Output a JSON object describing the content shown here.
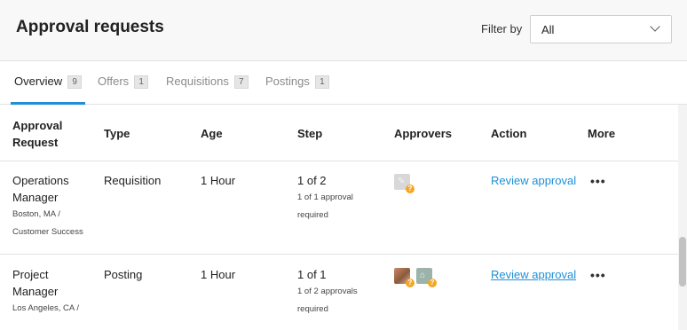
{
  "header": {
    "title": "Approval requests",
    "filter_label": "Filter by",
    "filter_value": "All"
  },
  "tabs": [
    {
      "label": "Overview",
      "count": "9",
      "active": true
    },
    {
      "label": "Offers",
      "count": "1",
      "active": false
    },
    {
      "label": "Requisitions",
      "count": "7",
      "active": false
    },
    {
      "label": "Postings",
      "count": "1",
      "active": false
    }
  ],
  "table": {
    "headers": {
      "request_line1": "Approval",
      "request_line2": "Request",
      "type": "Type",
      "age": "Age",
      "step": "Step",
      "approvers": "Approvers",
      "action": "Action",
      "more": "More"
    },
    "rows": [
      {
        "title_line1": "Operations",
        "title_line2": "Manager",
        "location_line1": "Boston, MA /",
        "location_line2": "Customer Success",
        "type": "Requisition",
        "age": "1 Hour",
        "step": "1 of 2",
        "step_note_line1": "1 of 1 approval",
        "step_note_line2": "required",
        "action": "Review approval",
        "more": "•••",
        "pending_mark": "?"
      },
      {
        "title_line1": "Project",
        "title_line2": "Manager",
        "location_line1": "Los Angeles, CA /",
        "type": "Posting",
        "age": "1 Hour",
        "step": "1 of 1",
        "step_note_line1": "1 of 2 approvals",
        "step_note_line2": "required",
        "action": "Review approval",
        "more": "•••",
        "pending_mark": "?"
      }
    ]
  },
  "icons": {
    "dropdown": "chevron-down-icon",
    "more": "more-horizontal-icon",
    "pending": "pending-status-icon"
  },
  "colors": {
    "accent": "#1f8fd6",
    "pending": "#f5a623",
    "header_bg": "#f8f8f8"
  }
}
